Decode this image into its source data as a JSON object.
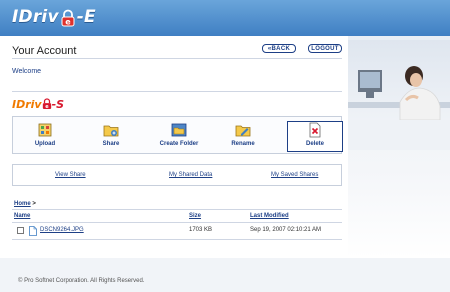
{
  "header": {
    "logo_prefix": "IDriv",
    "logo_suffix": "-E",
    "brand_color": "#3f7fc3"
  },
  "account": {
    "title": "Your Account",
    "back_label": "BACK",
    "logout_label": "LOGOUT",
    "welcome": "Welcome"
  },
  "brand": {
    "prefix": "IDriv",
    "suffix": "-S",
    "colors": {
      "prefix": "#f07a00",
      "suffix": "#d8182e"
    }
  },
  "toolbar": {
    "items": [
      {
        "label": "Upload",
        "icon": "upload-icon"
      },
      {
        "label": "Share",
        "icon": "share-folder-icon"
      },
      {
        "label": "Create Folder",
        "icon": "create-folder-icon"
      },
      {
        "label": "Rename",
        "icon": "rename-icon"
      },
      {
        "label": "Delete",
        "icon": "delete-icon"
      }
    ]
  },
  "subnav": {
    "view_share": "View Share",
    "my_shared_data": "My Shared Data",
    "my_saved_shares": "My Saved Shares"
  },
  "breadcrumb": {
    "home": "Home",
    "separator": ">"
  },
  "table": {
    "columns": [
      "Name",
      "Size",
      "Last Modified"
    ],
    "rows": [
      {
        "name": "DSCN9264.JPG",
        "size": "1703 KB",
        "modified": "Sep 19, 2007 02:10:21 AM"
      }
    ]
  },
  "footer": {
    "copyright": "© Pro Softnet Corporation. All Rights Reserved."
  }
}
